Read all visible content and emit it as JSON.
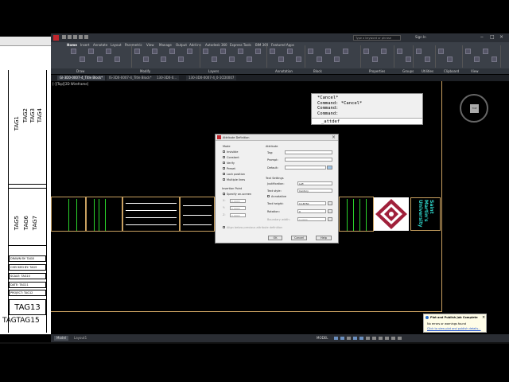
{
  "titlebar": {
    "search_placeholder": "Type a keyword or phrase",
    "sign_in": "Sign In"
  },
  "ribbon": {
    "tabs": [
      "Home",
      "Insert",
      "Annotate",
      "Layout",
      "Parametric",
      "View",
      "Manage",
      "Output",
      "Add-ins",
      "Autodesk 360",
      "Express Tools",
      "BIM 360",
      "Featured Apps"
    ],
    "groups": [
      "Draw",
      "Modify",
      "Layers",
      "Annotation",
      "Block",
      "Properties",
      "Groups",
      "Utilities",
      "Clipboard",
      "View"
    ]
  },
  "file_tabs": [
    "GI-3D0-0007-4_Title Block*",
    "IS-3D0-0007-4_Title Block*",
    "130-3D0-0...",
    "130-3D0-0007-4_0-1CD0007"
  ],
  "viewport_label": "[-][Top][2D Wireframe]",
  "left_sheet": {
    "tags_top": [
      "TAG1",
      "TAG2",
      "TAG3",
      "TAG4"
    ],
    "tags_mid": [
      "TAG5",
      "TAG6",
      "TAG7"
    ],
    "rows": [
      "DRAWN BY: TAG8",
      "CHECKED BY: TAG9",
      "SCALE: TAG10",
      "DATE: TAG11",
      "PROJECT: TAG12"
    ],
    "tag13": "TAG13",
    "bottom": "TAGTAG15"
  },
  "command": {
    "lines": [
      "*Cancel*",
      "Command: *Cancel*",
      "Command:",
      "Command:"
    ],
    "input": "_attdef"
  },
  "dialog": {
    "title": "Attribute Definition",
    "mode_header": "Mode",
    "modes": [
      "Invisible",
      "Constant",
      "Verify",
      "Preset",
      "Lock position",
      "Multiple lines"
    ],
    "modes_checked": [
      false,
      false,
      false,
      false,
      true,
      false
    ],
    "attribute_header": "Attribute",
    "tag_label": "Tag:",
    "prompt_label": "Prompt:",
    "default_label": "Default:",
    "insertion_header": "Insertion Point",
    "specify_on_screen": "Specify on-screen",
    "x_value": "0.0000",
    "y_value": "0.0000",
    "z_value": "0.0000",
    "text_settings_header": "Text Settings",
    "justification_label": "Justification:",
    "justification_value": "Left",
    "text_style_label": "Text style:",
    "text_style_value": "Century",
    "annotative": "Annotative",
    "text_height_label": "Text height:",
    "text_height_value": "0.18750",
    "rotation_label": "Rotation:",
    "rotation_value": "0",
    "boundary_width_label": "Boundary width:",
    "boundary_width_value": "0.0000",
    "align_below": "Align below previous attribute definition",
    "ok": "OK",
    "cancel": "Cancel",
    "help": "Help"
  },
  "university_text": [
    "Saint",
    "Martin's",
    "University"
  ],
  "notice": {
    "title": "Plot and Publish Job Complete",
    "line1": "No errors or warnings found",
    "link": "Click to view plot and publish details..."
  },
  "statusbar": {
    "tabs": [
      "Model",
      "Layout1"
    ],
    "mode": "MODEL"
  },
  "colors": {
    "frame": "#c8a060",
    "green_line": "#2bd42b",
    "uni_text": "#2ed3c8",
    "logo_red": "#a0203a"
  }
}
